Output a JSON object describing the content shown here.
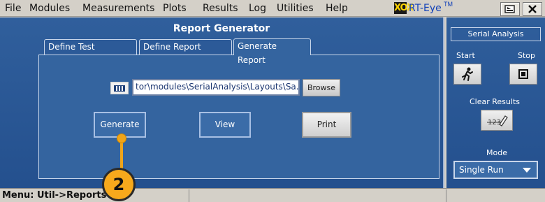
{
  "menu": {
    "items": [
      "File",
      "Modules",
      "Measurements",
      "Plots",
      "Results",
      "Log",
      "Utilities",
      "Help"
    ]
  },
  "app": {
    "logo_mark": "XOX",
    "product": "RT-Eye",
    "tm": "TM"
  },
  "panel": {
    "title": "Report Generator",
    "tabs": [
      "Define Test Template",
      "Define Report Layout",
      "Generate Report"
    ],
    "active_tab": "Generate Report",
    "path_value": "tor\\modules\\SerialAnalysis\\Layouts\\Sa.rpl",
    "browse_label": "Browse",
    "buttons": {
      "generate": "Generate",
      "view": "View",
      "print": "Print"
    }
  },
  "callout": {
    "number": "2"
  },
  "status": {
    "text": "Menu: Util->Reports"
  },
  "side": {
    "title": "Serial Analysis",
    "start_label": "Start",
    "stop_label": "Stop",
    "clear_label": "Clear Results",
    "clear_icon_text": "123",
    "mode_label": "Mode",
    "mode_value": "Single Run"
  },
  "colors": {
    "panel_blue": "#2c5a98",
    "accent_orange": "#f7a91c"
  },
  "icons": [
    "file-icon",
    "run-icon",
    "stop-icon",
    "eraser-icon",
    "chevron-down-icon",
    "minimize-icon",
    "close-icon"
  ]
}
